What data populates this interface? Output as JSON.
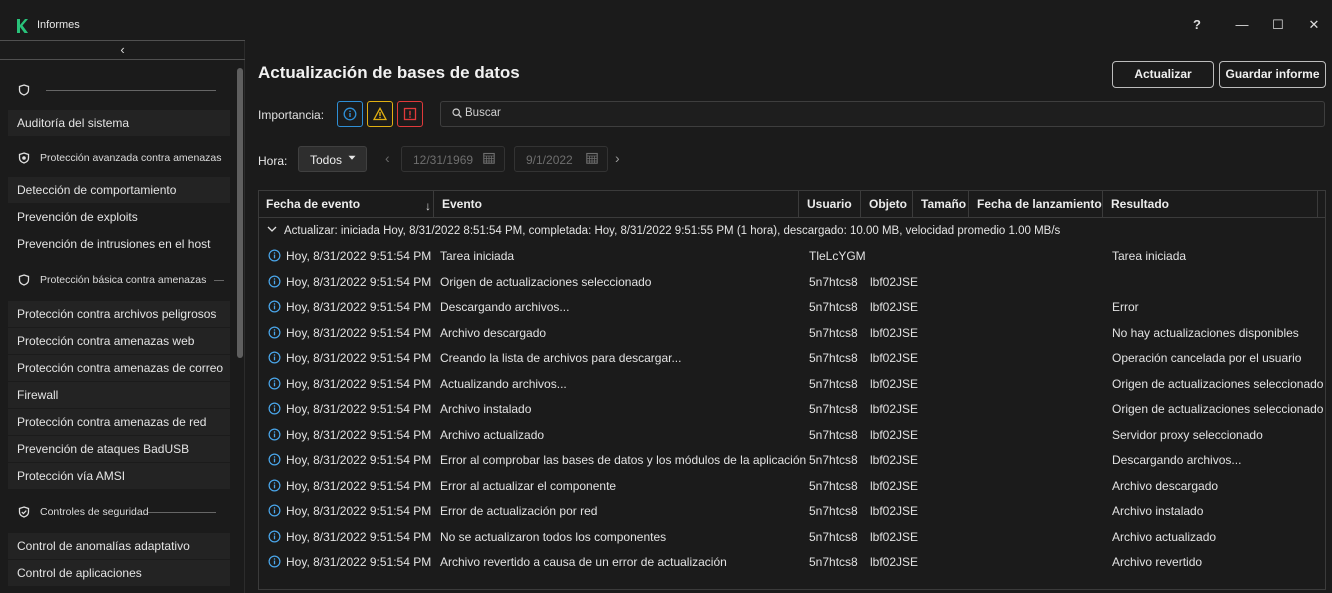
{
  "window": {
    "title": "Informes",
    "help_label": "?",
    "minimize_label": "—",
    "maximize_label": "☐",
    "close_label": "✕"
  },
  "sidebar": {
    "collapse_label": "‹",
    "groups": [
      {
        "label": "",
        "icon": "shield-outline-icon"
      },
      {
        "label": "Protección avanzada contra amenazas",
        "icon": "shield-gear-icon"
      },
      {
        "label": "Protección básica contra amenazas",
        "icon": "shield-outline-icon"
      },
      {
        "label": "Controles de seguridad",
        "icon": "shield-check-icon"
      }
    ],
    "items": [
      "Auditoría del sistema",
      "Detección de comportamiento",
      "Prevención de exploits",
      "Prevención de intrusiones en el host",
      "Protección contra archivos peligrosos",
      "Protección contra amenazas web",
      "Protección contra amenazas de correo",
      "Firewall",
      "Protección contra amenazas de red",
      "Prevención de ataques BadUSB",
      "Protección vía AMSI",
      "Control de anomalías adaptativo",
      "Control de aplicaciones"
    ]
  },
  "main": {
    "title": "Actualización de bases de datos",
    "update_button": "Actualizar",
    "save_button": "Guardar informe",
    "importance_label": "Importancia:",
    "search_placeholder": "Buscar",
    "time_label": "Hora:",
    "time_value": "Todos",
    "date_from": "12/31/1969",
    "date_to": "9/1/2022"
  },
  "table": {
    "columns": [
      "Fecha de evento",
      "Evento",
      "Usuario",
      "Objeto",
      "Tamaño",
      "Fecha de lanzamiento",
      "Resultado"
    ],
    "sort_indicator": "↓",
    "group_text": "Actualizar: iniciada Hoy, 8/31/2022 8:51:54 PM, completada: Hoy, 8/31/2022 9:51:55 PM (1 hora), descargado: 10.00 MB, velocidad promedio 1.00 MB/s",
    "rows": [
      {
        "date": "Hoy, 8/31/2022 9:51:54 PM",
        "event": "Tarea iniciada",
        "user": "TleLcYGM",
        "object": "",
        "result": "Tarea iniciada"
      },
      {
        "date": "Hoy, 8/31/2022 9:51:54 PM",
        "event": "Origen de actualizaciones seleccionado",
        "user": "5n7htcs8",
        "object": "lbf02JSE",
        "result": ""
      },
      {
        "date": "Hoy, 8/31/2022 9:51:54 PM",
        "event": "Descargando archivos...",
        "user": "5n7htcs8",
        "object": "lbf02JSE",
        "result": "Error"
      },
      {
        "date": "Hoy, 8/31/2022 9:51:54 PM",
        "event": "Archivo descargado",
        "user": "5n7htcs8",
        "object": "lbf02JSE",
        "result": "No hay actualizaciones disponibles"
      },
      {
        "date": "Hoy, 8/31/2022 9:51:54 PM",
        "event": "Creando la lista de archivos para descargar...",
        "user": "5n7htcs8",
        "object": "lbf02JSE",
        "result": "Operación cancelada por el usuario"
      },
      {
        "date": "Hoy, 8/31/2022 9:51:54 PM",
        "event": "Actualizando archivos...",
        "user": "5n7htcs8",
        "object": "lbf02JSE",
        "result": "Origen de actualizaciones seleccionado"
      },
      {
        "date": "Hoy, 8/31/2022 9:51:54 PM",
        "event": "Archivo instalado",
        "user": "5n7htcs8",
        "object": "lbf02JSE",
        "result": "Origen de actualizaciones seleccionado"
      },
      {
        "date": "Hoy, 8/31/2022 9:51:54 PM",
        "event": "Archivo actualizado",
        "user": "5n7htcs8",
        "object": "lbf02JSE",
        "result": "Servidor proxy seleccionado"
      },
      {
        "date": "Hoy, 8/31/2022 9:51:54 PM",
        "event": "Error al comprobar las bases de datos y los módulos de la aplicación",
        "user": "5n7htcs8",
        "object": "lbf02JSE",
        "result": "Descargando archivos..."
      },
      {
        "date": "Hoy, 8/31/2022 9:51:54 PM",
        "event": "Error al actualizar el componente",
        "user": "5n7htcs8",
        "object": "lbf02JSE",
        "result": "Archivo descargado"
      },
      {
        "date": "Hoy, 8/31/2022 9:51:54 PM",
        "event": "Error de actualización por red",
        "user": "5n7htcs8",
        "object": "lbf02JSE",
        "result": "Archivo instalado"
      },
      {
        "date": "Hoy, 8/31/2022 9:51:54 PM",
        "event": "No se actualizaron todos los componentes",
        "user": "5n7htcs8",
        "object": "lbf02JSE",
        "result": "Archivo actualizado"
      },
      {
        "date": "Hoy, 8/31/2022 9:51:54 PM",
        "event": "Archivo revertido a causa de un error de actualización",
        "user": "5n7htcs8",
        "object": "lbf02JSE",
        "result": "Archivo revertido"
      }
    ]
  },
  "colors": {
    "accent_logo": "#29c27a",
    "info": "#2e8fd6",
    "warning": "#e2b012",
    "critical": "#e03a3a"
  }
}
